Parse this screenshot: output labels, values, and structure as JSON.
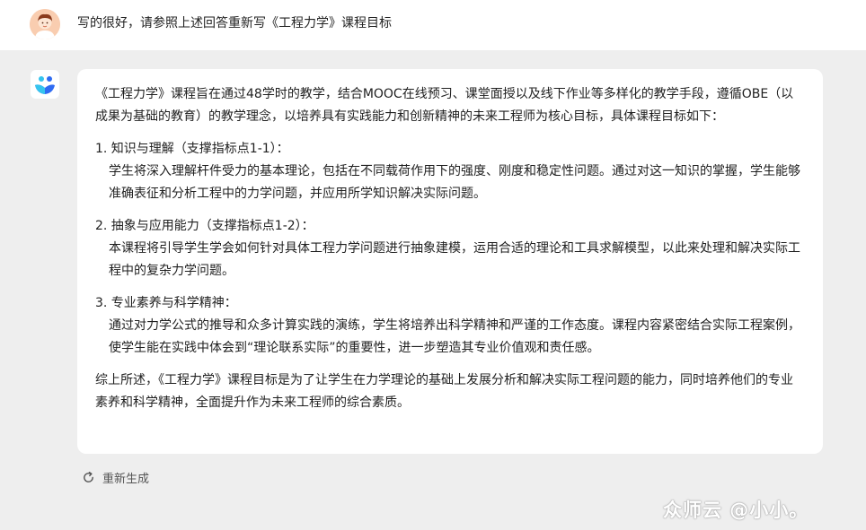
{
  "user_message": {
    "text": "写的很好，请参照上述回答重新写《工程力学》课程目标"
  },
  "response": {
    "intro": "《工程力学》课程旨在通过48学时的教学，结合MOOC在线预习、课堂面授以及线下作业等多样化的教学手段，遵循OBE（以成果为基础的教育）的教学理念，以培养具有实践能力和创新精神的未来工程师为核心目标，具体课程目标如下：",
    "items": [
      {
        "title": "1. 知识与理解（支撑指标点1-1）：",
        "body": "学生将深入理解杆件受力的基本理论，包括在不同载荷作用下的强度、刚度和稳定性问题。通过对这一知识的掌握，学生能够准确表征和分析工程中的力学问题，并应用所学知识解决实际问题。"
      },
      {
        "title": "2. 抽象与应用能力（支撑指标点1-2）：",
        "body": "本课程将引导学生学会如何针对具体工程力学问题进行抽象建模，运用合适的理论和工具求解模型，以此来处理和解决实际工程中的复杂力学问题。"
      },
      {
        "title": "3. 专业素养与科学精神：",
        "body": "通过对力学公式的推导和众多计算实践的演练，学生将培养出科学精神和严谨的工作态度。课程内容紧密结合实际工程案例，使学生能在实践中体会到“理论联系实际”的重要性，进一步塑造其专业价值观和责任感。"
      }
    ],
    "summary": "综上所述，《工程力学》课程目标是为了让学生在力学理论的基础上发展分析和解决实际工程问题的能力，同时培养他们的专业素养和科学精神，全面提升作为未来工程师的综合素质。"
  },
  "actions": {
    "regenerate_label": "重新生成"
  },
  "watermark": {
    "text": "众师云 @小小。"
  },
  "colors": {
    "page_background": "#eeeeee",
    "card_background": "#ffffff",
    "bot_logo_blue": "#2f6bf2",
    "bot_logo_cyan": "#35c4ee"
  }
}
